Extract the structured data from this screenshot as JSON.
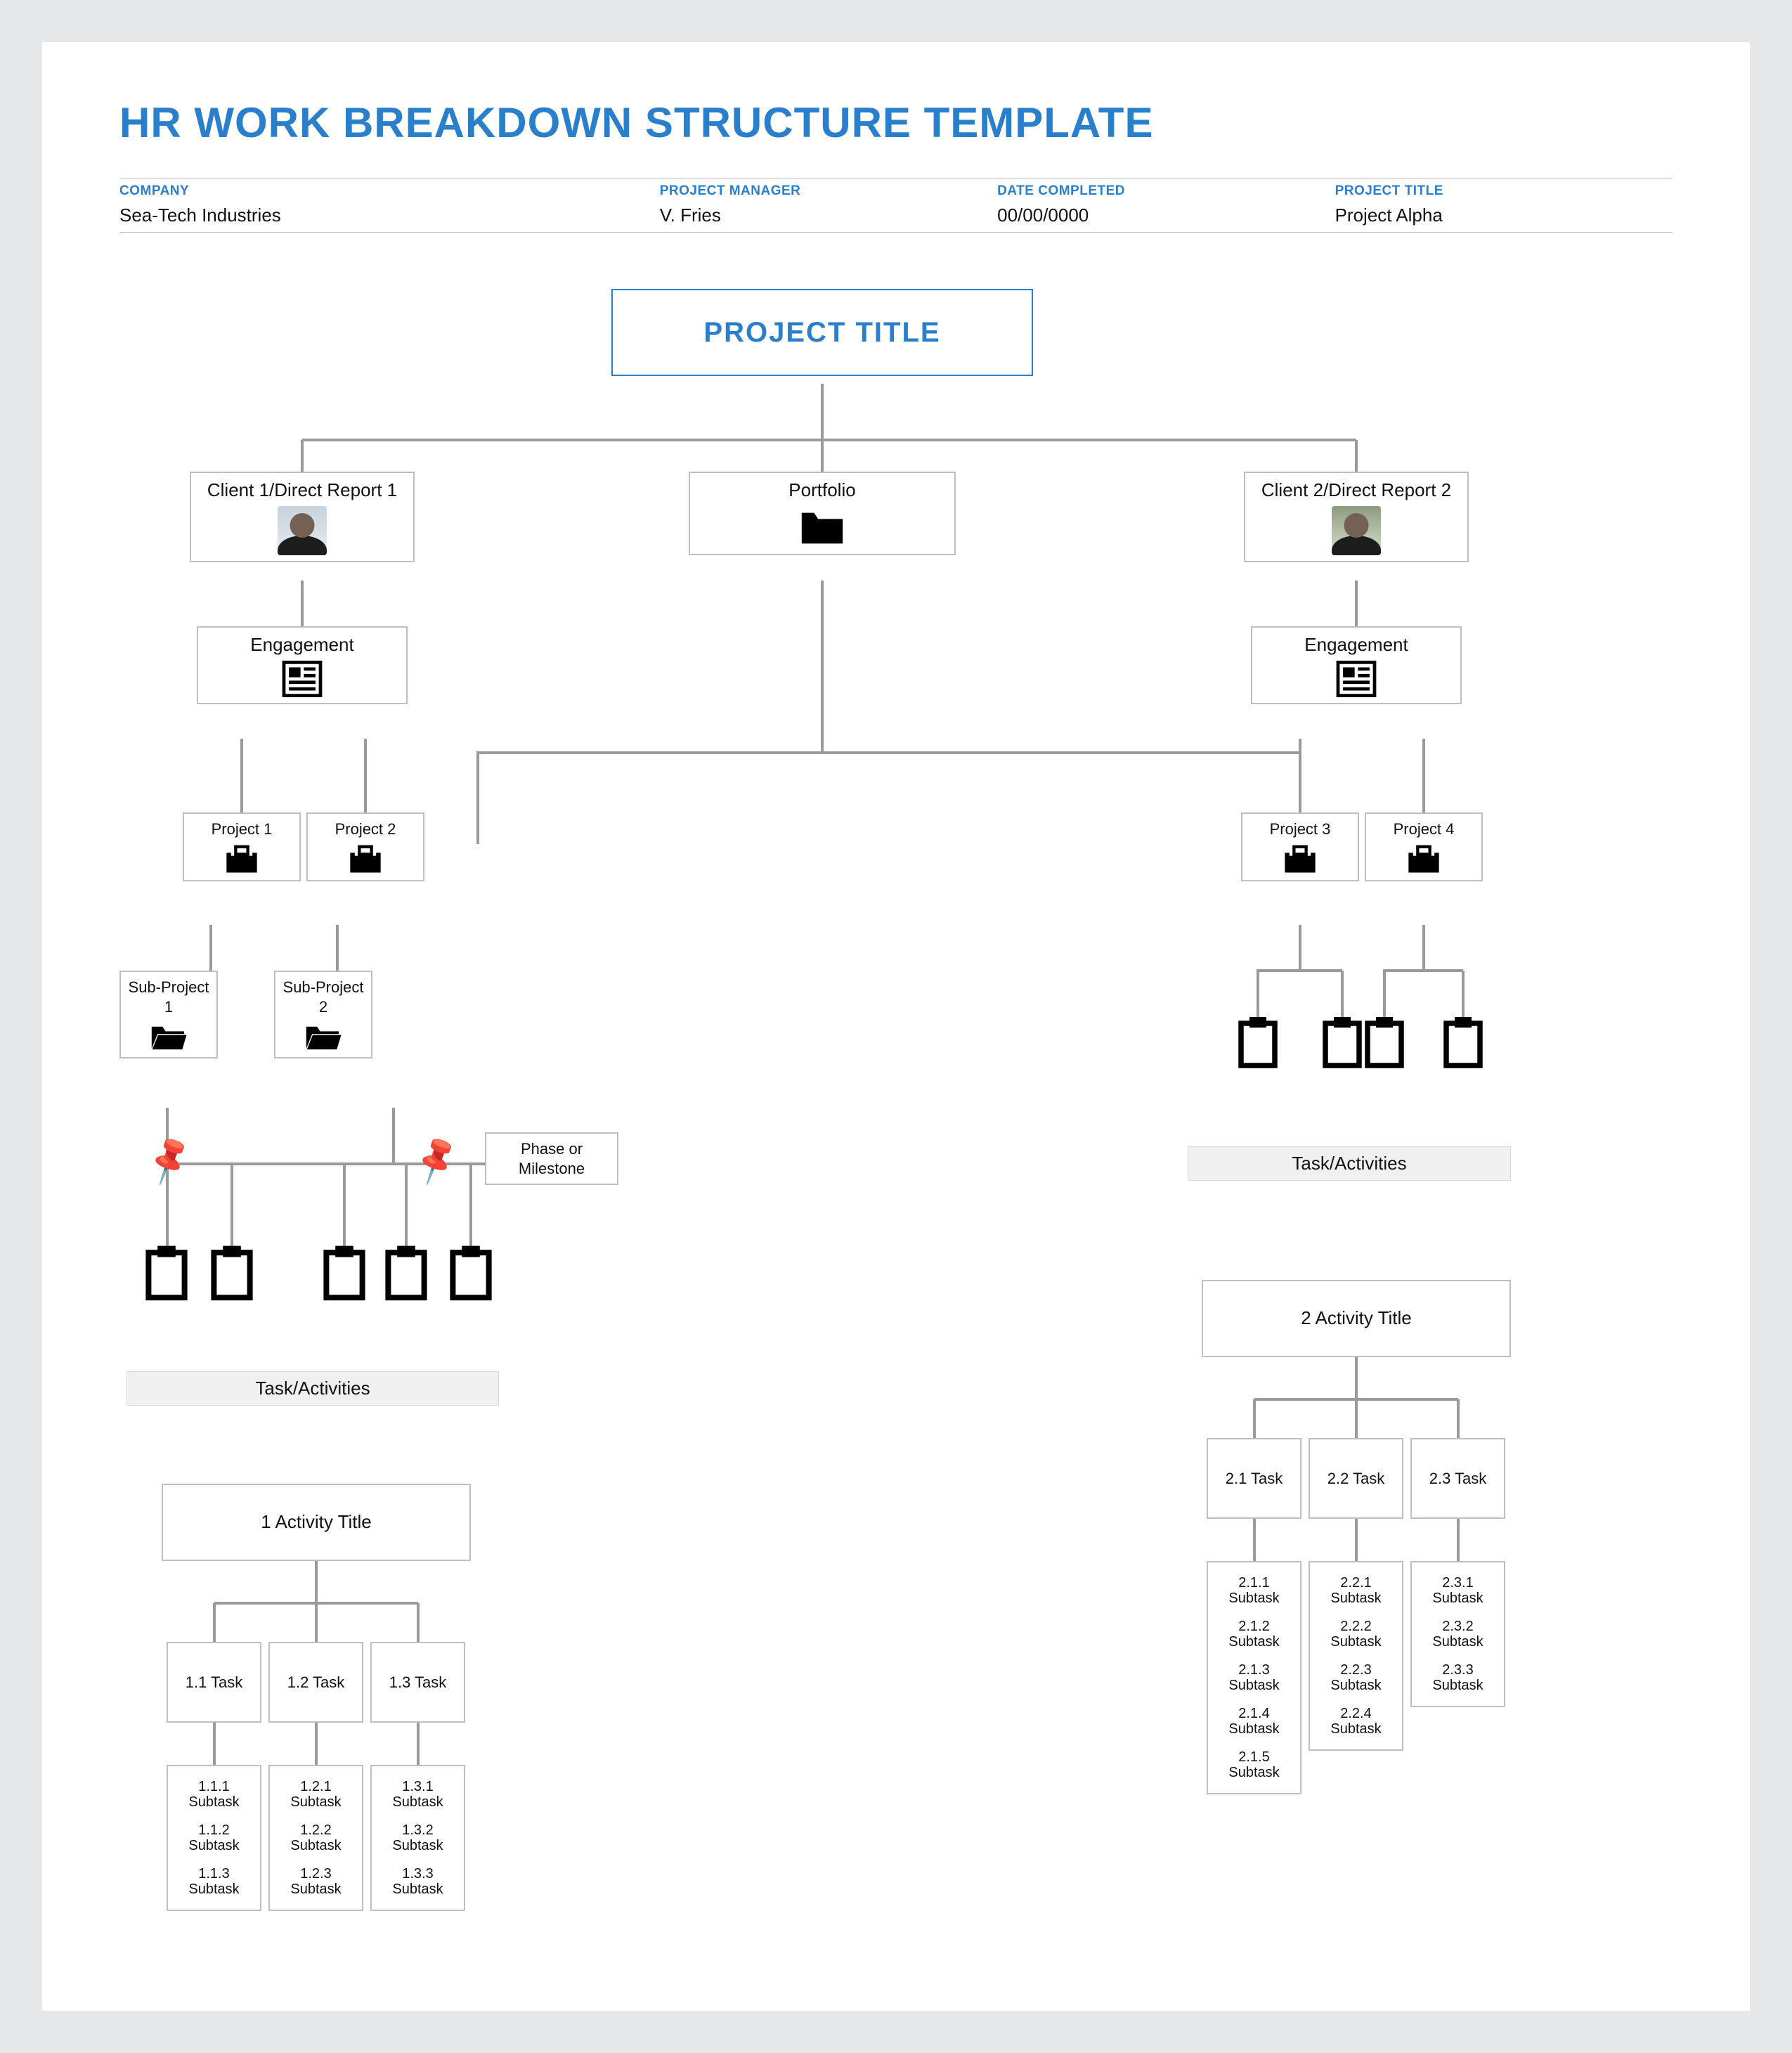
{
  "title": "HR WORK BREAKDOWN STRUCTURE TEMPLATE",
  "header": {
    "company_label": "COMPANY",
    "company": "Sea-Tech Industries",
    "pm_label": "PROJECT MANAGER",
    "pm": "V. Fries",
    "date_label": "DATE COMPLETED",
    "date": "00/00/0000",
    "ptitle_label": "PROJECT TITLE",
    "ptitle": "Project Alpha"
  },
  "boxes": {
    "project_title": "PROJECT TITLE",
    "client1": "Client 1/Direct Report 1",
    "portfolio": "Portfolio",
    "client2": "Client 2/Direct Report 2",
    "engagement": "Engagement",
    "project1": "Project 1",
    "project2": "Project 2",
    "project3": "Project 3",
    "project4": "Project 4",
    "sub1": "Sub-Project 1",
    "sub2": "Sub-Project 2",
    "phase": "Phase or Milestone",
    "task_activities": "Task/Activities",
    "activity1": "1 Activity Title",
    "activity2": "2 Activity Title",
    "t11": "1.1 Task",
    "t12": "1.2 Task",
    "t13": "1.3 Task",
    "t21": "2.1 Task",
    "t22": "2.2 Task",
    "t23": "2.3 Task"
  },
  "subtasks": {
    "g11": [
      [
        "1.1.1",
        "Subtask"
      ],
      [
        "1.1.2",
        "Subtask"
      ],
      [
        "1.1.3",
        "Subtask"
      ]
    ],
    "g12": [
      [
        "1.2.1",
        "Subtask"
      ],
      [
        "1.2.2",
        "Subtask"
      ],
      [
        "1.2.3",
        "Subtask"
      ]
    ],
    "g13": [
      [
        "1.3.1",
        "Subtask"
      ],
      [
        "1.3.2",
        "Subtask"
      ],
      [
        "1.3.3",
        "Subtask"
      ]
    ],
    "g21": [
      [
        "2.1.1",
        "Subtask"
      ],
      [
        "2.1.2",
        "Subtask"
      ],
      [
        "2.1.3",
        "Subtask"
      ],
      [
        "2.1.4",
        "Subtask"
      ],
      [
        "2.1.5",
        "Subtask"
      ]
    ],
    "g22": [
      [
        "2.2.1",
        "Subtask"
      ],
      [
        "2.2.2",
        "Subtask"
      ],
      [
        "2.2.3",
        "Subtask"
      ],
      [
        "2.2.4",
        "Subtask"
      ]
    ],
    "g23": [
      [
        "2.3.1",
        "Subtask"
      ],
      [
        "2.3.2",
        "Subtask"
      ],
      [
        "2.3.3",
        "Subtask"
      ]
    ]
  }
}
